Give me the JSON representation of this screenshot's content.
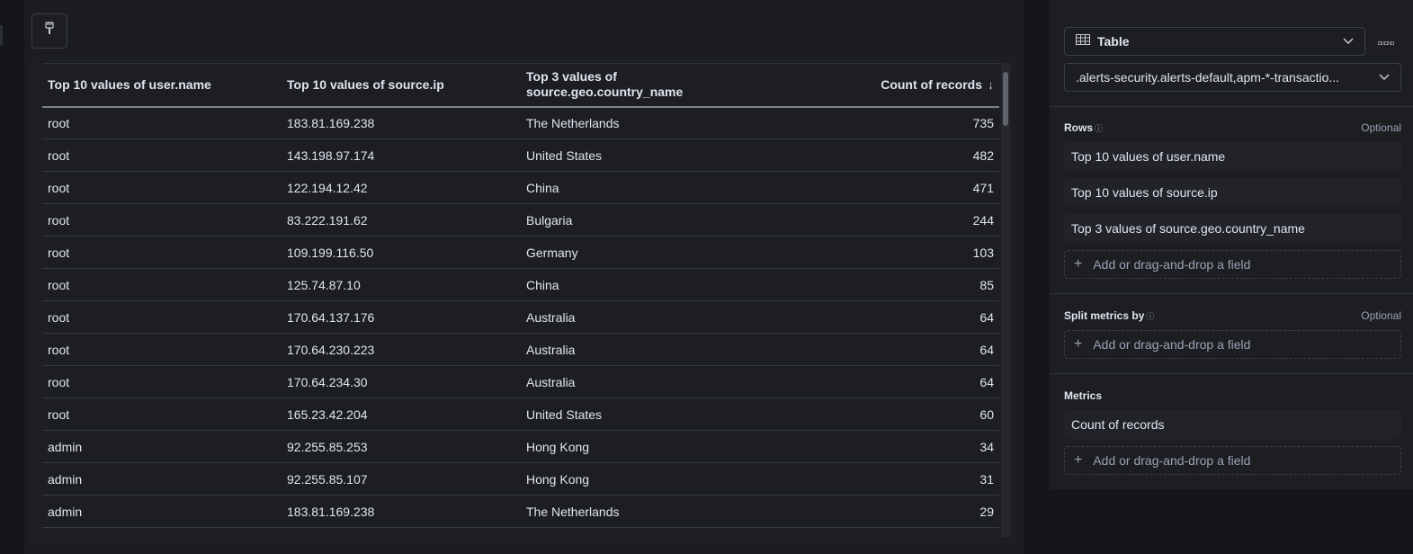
{
  "toolbar": {
    "brush_icon": "paintbrush-icon"
  },
  "table": {
    "columns": [
      "Top 10 values of user.name",
      "Top 10 values of source.ip",
      "Top 3 values of source.geo.country_name",
      "Count of records"
    ],
    "sort_indicator": "↓",
    "rows": [
      [
        "root",
        "183.81.169.238",
        "The Netherlands",
        "735"
      ],
      [
        "root",
        "143.198.97.174",
        "United States",
        "482"
      ],
      [
        "root",
        "122.194.12.42",
        "China",
        "471"
      ],
      [
        "root",
        "83.222.191.62",
        "Bulgaria",
        "244"
      ],
      [
        "root",
        "109.199.116.50",
        "Germany",
        "103"
      ],
      [
        "root",
        "125.74.87.10",
        "China",
        "85"
      ],
      [
        "root",
        "170.64.137.176",
        "Australia",
        "64"
      ],
      [
        "root",
        "170.64.230.223",
        "Australia",
        "64"
      ],
      [
        "root",
        "170.64.234.30",
        "Australia",
        "64"
      ],
      [
        "root",
        "165.23.42.204",
        "United States",
        "60"
      ],
      [
        "admin",
        "92.255.85.253",
        "Hong Kong",
        "34"
      ],
      [
        "admin",
        "92.255.85.107",
        "Hong Kong",
        "31"
      ],
      [
        "admin",
        "183.81.169.238",
        "The Netherlands",
        "29"
      ]
    ]
  },
  "config": {
    "visualization_type": "Table",
    "layer_source": ".alerts-security.alerts-default,apm-*-transactio...",
    "more_icon": "ellipsis-icon",
    "rows_section": {
      "title": "Rows",
      "optional": "Optional",
      "fields": [
        "Top 10 values of user.name",
        "Top 10 values of source.ip",
        "Top 3 values of source.geo.country_name"
      ],
      "add_label": "Add or drag-and-drop a field"
    },
    "split_section": {
      "title": "Split metrics by",
      "optional": "Optional",
      "add_label": "Add or drag-and-drop a field"
    },
    "metrics_section": {
      "title": "Metrics",
      "fields": [
        "Count of records"
      ],
      "add_label": "Add or drag-and-drop a field"
    }
  }
}
